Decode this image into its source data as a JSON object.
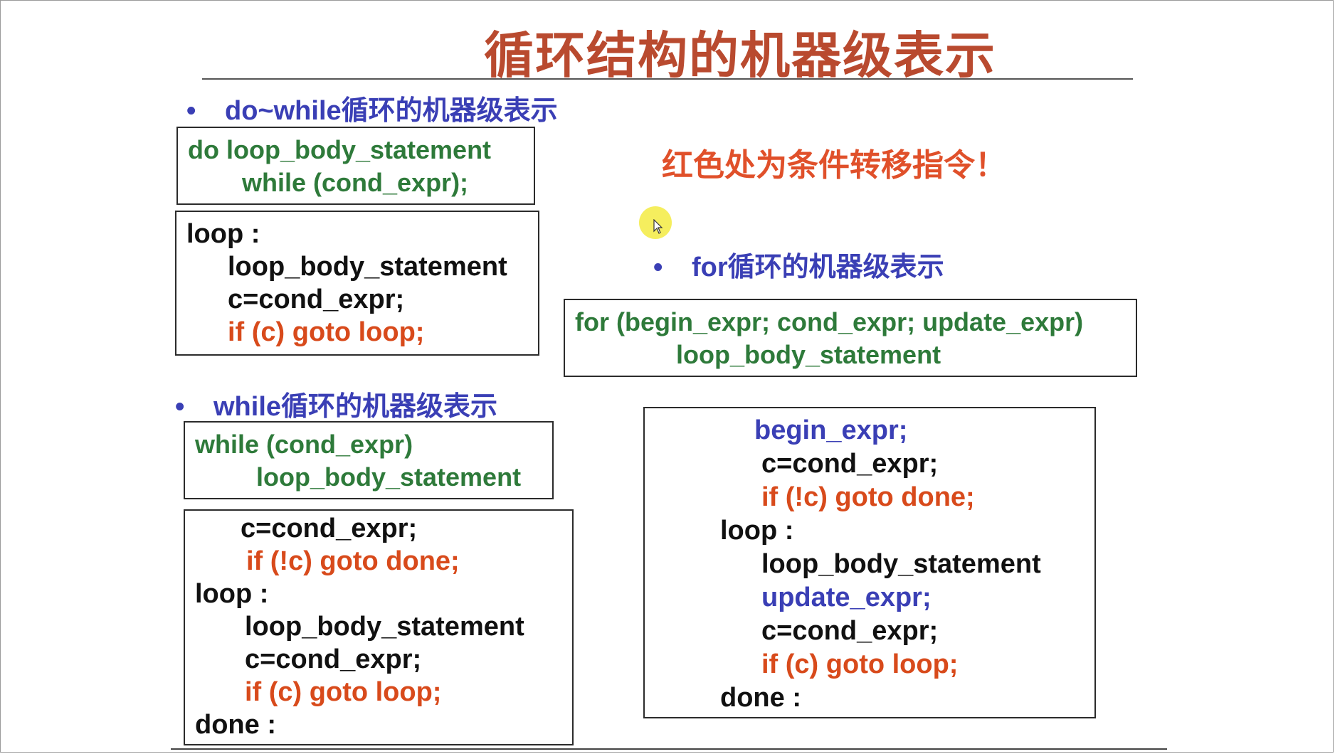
{
  "title": "循环结构的机器级表示",
  "note": "红色处为条件转移指令！",
  "do_while": {
    "heading": "do~while循环的机器级表示",
    "source": [
      "do  loop_body_statement",
      "while (cond_expr);"
    ],
    "machine": [
      "loop :",
      "loop_body_statement",
      "c=cond_expr;",
      "if (c) goto loop;"
    ]
  },
  "while_loop": {
    "heading": "while循环的机器级表示",
    "source": [
      "while (cond_expr)",
      "loop_body_statement"
    ],
    "machine": [
      "c=cond_expr;",
      "if (!c) goto done;",
      "loop :",
      "loop_body_statement",
      "c=cond_expr;",
      "if (c) goto loop;",
      "done :"
    ]
  },
  "for_loop": {
    "heading": "for循环的机器级表示",
    "source": [
      "for (begin_expr; cond_expr; update_expr)",
      "loop_body_statement"
    ],
    "machine": [
      "begin_expr;",
      "c=cond_expr;",
      "if (!c) goto done;",
      "loop :",
      "loop_body_statement",
      "update_expr;",
      "c=cond_expr;",
      "if (c) goto loop;",
      "done :"
    ]
  },
  "colors": {
    "title": "#b94a2f",
    "heading": "#3a3fb5",
    "source_code": "#2e7a3a",
    "conditional_jump": "#d84a1b",
    "note": "#e0502a"
  },
  "icons": [
    "bullet-icon",
    "cursor-highlight-icon",
    "mouse-pointer-icon"
  ]
}
